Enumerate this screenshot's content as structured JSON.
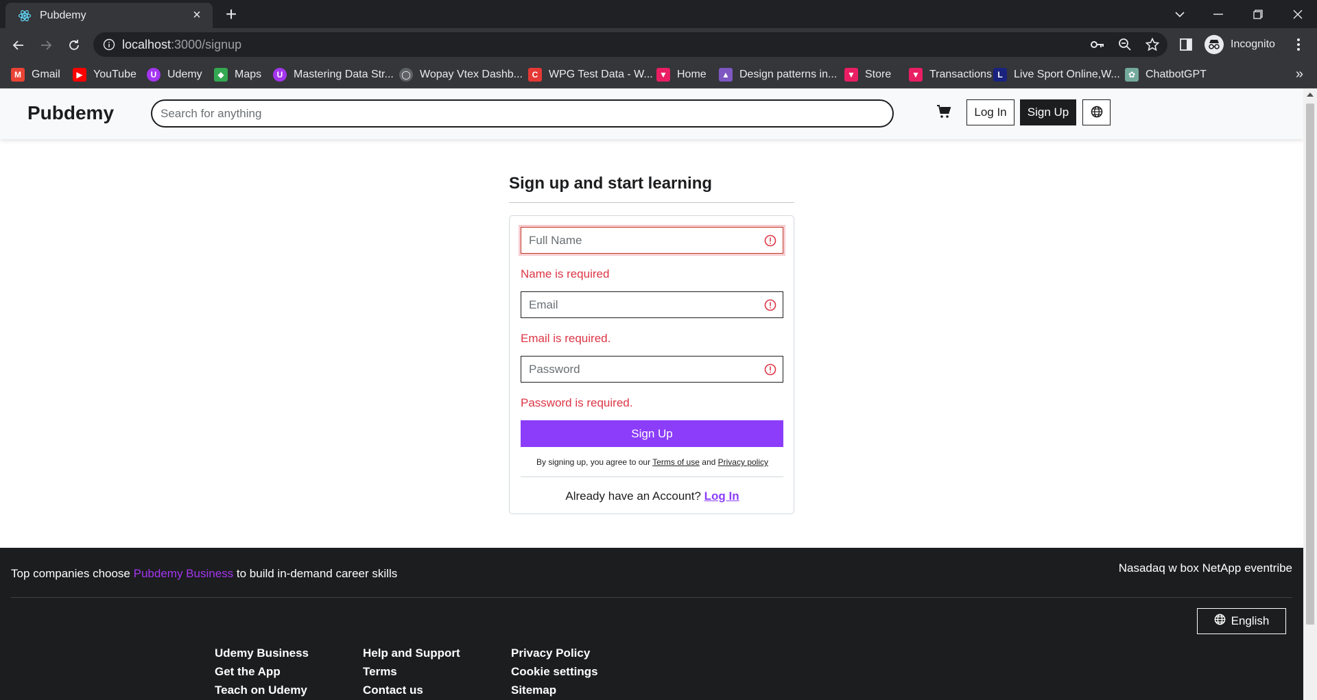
{
  "browser": {
    "tab_title": "Pubdemy",
    "url_host": "localhost",
    "url_path": ":3000/signup",
    "profile_label": "Incognito",
    "bookmarks": [
      {
        "label": "Gmail",
        "icon": "gmail-icon",
        "color": "#ea4335"
      },
      {
        "label": "YouTube",
        "icon": "youtube-icon",
        "color": "#ff0000"
      },
      {
        "label": "Udemy",
        "icon": "udemy-icon",
        "color": "#a435f0"
      },
      {
        "label": "Maps",
        "icon": "maps-icon",
        "color": "#34a853"
      },
      {
        "label": "Mastering Data Str...",
        "icon": "udemy-icon",
        "color": "#a435f0"
      },
      {
        "label": "Wopay Vtex Dashb...",
        "icon": "circle-icon",
        "color": "#5f6368"
      },
      {
        "label": "WPG Test Data - W...",
        "icon": "c-icon",
        "color": "#e53935"
      },
      {
        "label": "Home",
        "icon": "tag-icon",
        "color": "#e91e63"
      },
      {
        "label": "Design patterns in...",
        "icon": "rocket-icon",
        "color": "#7e57c2"
      },
      {
        "label": "Store",
        "icon": "tag-icon",
        "color": "#e91e63"
      },
      {
        "label": "Transactions",
        "icon": "tag-icon",
        "color": "#e91e63"
      },
      {
        "label": "Live Sport Online,W...",
        "icon": "live-icon",
        "color": "#1a237e"
      },
      {
        "label": "ChatbotGPT",
        "icon": "chatgpt-icon",
        "color": "#74aa9c"
      }
    ]
  },
  "header": {
    "brand": "Pubdemy",
    "search_placeholder": "Search for anything",
    "login_label": "Log In",
    "signup_label": "Sign Up"
  },
  "signup": {
    "title": "Sign up and start learning",
    "fields": [
      {
        "placeholder": "Full Name",
        "error": "Name is required"
      },
      {
        "placeholder": "Email",
        "error": "Email is required."
      },
      {
        "placeholder": "Password",
        "error": "Password is required."
      }
    ],
    "submit_label": "Sign Up",
    "terms_prefix": "By signing up, you agree to our",
    "terms_link": "Terms of use",
    "terms_and": "and",
    "privacy_link": "Privacy policy",
    "have_account": "Already have an Account?",
    "login_link": "Log In"
  },
  "footer": {
    "tag_prefix": "Top companies choose",
    "tag_brand": "Pubdemy Business",
    "tag_suffix": "to build in-demand career skills",
    "companies": "Nasadaq w box NetApp eventribe",
    "language_label": "English",
    "columns": [
      [
        "Udemy Business",
        "Get the App",
        "Teach on Udemy"
      ],
      [
        "Help and Support",
        "Terms",
        "Contact us"
      ],
      [
        "Privacy Policy",
        "Cookie settings",
        "Sitemap"
      ]
    ]
  },
  "colors": {
    "accent": "#8c3dfa",
    "error": "#dc3545",
    "footer_bg": "#1c1d1f"
  }
}
